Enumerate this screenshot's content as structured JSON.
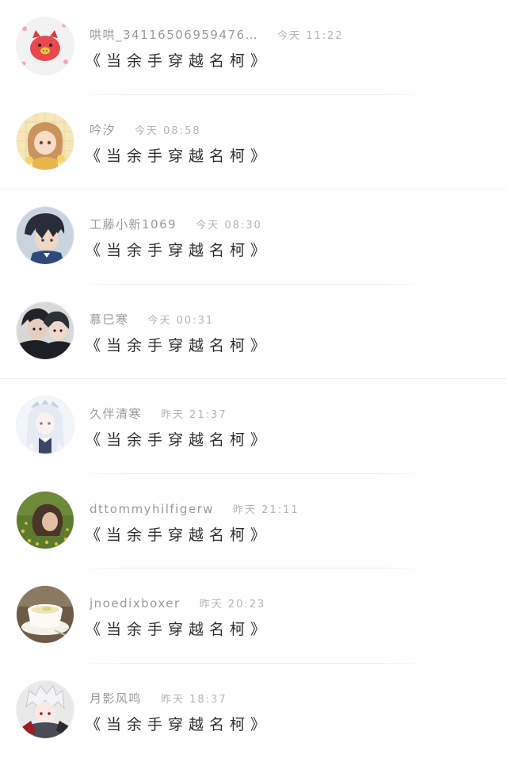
{
  "comments": [
    {
      "username": "哄哄_34116506959476…",
      "time": "今天 11:22",
      "message": "《当余手穿越名柯》",
      "avatar": "pink-pig-avatar",
      "colors": [
        "#f2f2f2",
        "#e8484f",
        "#f6a4b4"
      ]
    },
    {
      "username": "吟汐",
      "time": "今天 08:58",
      "message": "《当余手穿越名柯》",
      "avatar": "anime-girl-avatar",
      "colors": [
        "#f5e7b8",
        "#c9935c",
        "#e8b64a"
      ]
    },
    {
      "username": "工藤小新1069",
      "time": "今天 08:30",
      "message": "《当余手穿越名柯》",
      "avatar": "anime-boy-avatar",
      "colors": [
        "#c9d4df",
        "#2a2d38",
        "#f0d7c4"
      ]
    },
    {
      "username": "慕巳寒",
      "time": "今天 00:31",
      "message": "《当余手穿越名柯》",
      "avatar": "anime-couple-avatar",
      "colors": [
        "#d8d8d8",
        "#22232a",
        "#e6cdbd"
      ]
    },
    {
      "username": "久伴清寒",
      "time": "昨天 21:37",
      "message": "《当余手穿越名柯》",
      "avatar": "white-hair-girl-avatar",
      "colors": [
        "#f2f5fa",
        "#c8d0e0",
        "#7b86a6"
      ]
    },
    {
      "username": "dttommyhilfigerw",
      "time": "昨天 21:11",
      "message": "《当余手穿越名柯》",
      "avatar": "flower-field-photo-avatar",
      "colors": [
        "#5e7a2e",
        "#d7c23e",
        "#4a3528"
      ]
    },
    {
      "username": "jnoedixboxer",
      "time": "昨天 20:23",
      "message": "《当余手穿越名柯》",
      "avatar": "pudding-bowl-avatar",
      "colors": [
        "#6b5a46",
        "#fbfaf3",
        "#d9d08a"
      ]
    },
    {
      "username": "月影风鸣",
      "time": "昨天 18:37",
      "message": "《当余手穿越名柯》",
      "avatar": "white-hair-boy-avatar",
      "colors": [
        "#e9e9e9",
        "#9c1d22",
        "#4b4b55"
      ]
    }
  ]
}
